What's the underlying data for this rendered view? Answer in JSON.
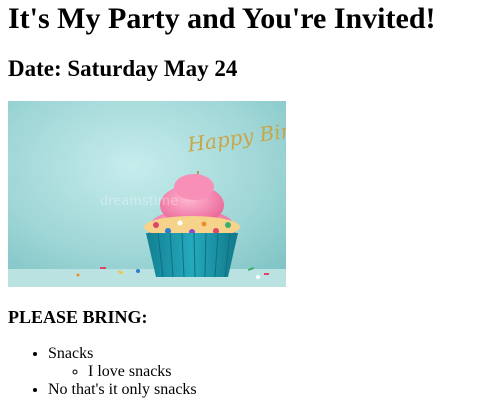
{
  "title": "It's My Party and You're Invited!",
  "date_heading": "Date: Saturday May 24",
  "image": {
    "description_icon": "cupcake-birthday-photo",
    "topper_text": "Happy Birthday",
    "watermark": "dreamstime",
    "colors": {
      "background": "#9fd6d6",
      "frosting": "#f27aa8",
      "cup": "#1f9bb0",
      "topper": "#c9a548"
    }
  },
  "bring_heading": "PLEASE BRING:",
  "items": [
    {
      "label": "Snacks",
      "sub": [
        "I love snacks"
      ]
    },
    {
      "label": "No that's it only snacks",
      "sub": []
    }
  ]
}
